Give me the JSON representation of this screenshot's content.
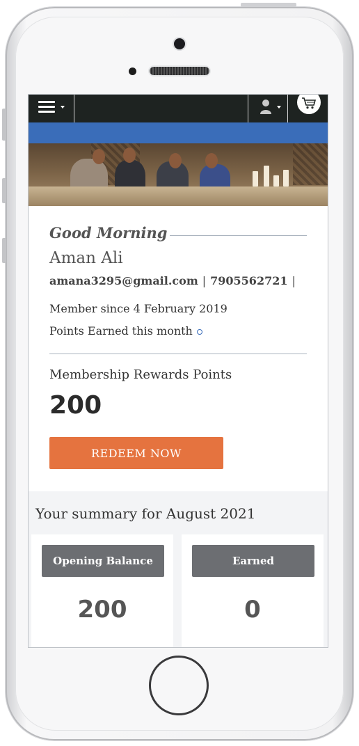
{
  "header": {
    "menu_icon": "hamburger-menu-icon",
    "user_icon": "user-icon",
    "cart_icon": "cart-icon",
    "bar_color": "#1e2321",
    "band_color": "#3a6db9"
  },
  "profile": {
    "greeting": "Good Morning",
    "name": "Aman Ali",
    "email": "amana3295@gmail.com",
    "phone": "7905562721",
    "separator": "|",
    "member_since": "Member since 4 February 2019",
    "points_earned_label": "Points Earned this month"
  },
  "rewards": {
    "label": "Membership Rewards Points",
    "value": "200",
    "redeem_button": "REDEEM NOW",
    "button_color": "#e5733f"
  },
  "summary": {
    "title": "Your summary for August 2021",
    "cards": [
      {
        "label": "Opening Balance",
        "value": "200"
      },
      {
        "label": "Earned",
        "value": "0"
      }
    ]
  }
}
